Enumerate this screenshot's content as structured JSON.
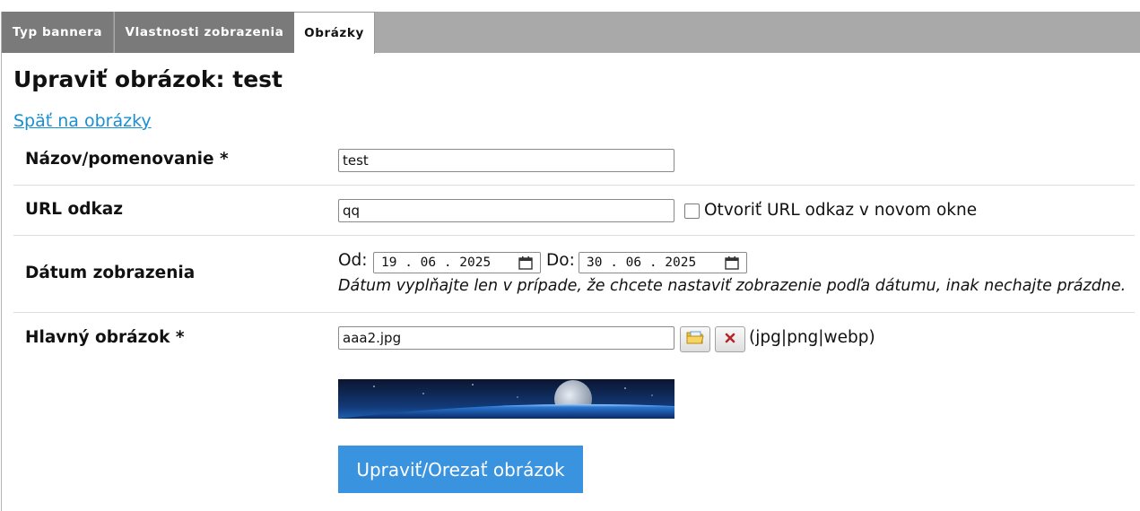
{
  "tabs": [
    {
      "label": "Typ bannera",
      "active": false
    },
    {
      "label": "Vlastnosti zobrazenia",
      "active": false
    },
    {
      "label": "Obrázky",
      "active": true
    }
  ],
  "page": {
    "title": "Upraviť obrázok: test",
    "back_link": "Späť na obrázky"
  },
  "form": {
    "name": {
      "label": "Názov/pomenovanie *",
      "value": "test"
    },
    "url": {
      "label": "URL odkaz",
      "value": "qq",
      "new_window_label": "Otvoriť URL odkaz v novom okne",
      "new_window_checked": false
    },
    "date": {
      "label": "Dátum zobrazenia",
      "from_label": "Od:",
      "from_value": "19 . 06 . 2025",
      "to_label": "Do:",
      "to_value": "30 . 06 . 2025",
      "hint": "Dátum vyplňajte len v prípade, že chcete nastaviť zobrazenie podľa dátumu, inak nechajte prázdne."
    },
    "image": {
      "label": "Hlavný obrázok *",
      "value": "aaa2.jpg",
      "formats": "(jpg|png|webp)",
      "edit_button": "Upraviť/Orezať obrázok"
    }
  },
  "colors": {
    "link": "#1a8fd1",
    "primary_button": "#3a93de",
    "tab_bar": "#a9a9a9",
    "tab_inactive": "#7a7a7a"
  },
  "icons": {
    "browse": "folder-image-icon",
    "clear": "close-x-icon",
    "calendar": "calendar-icon"
  }
}
